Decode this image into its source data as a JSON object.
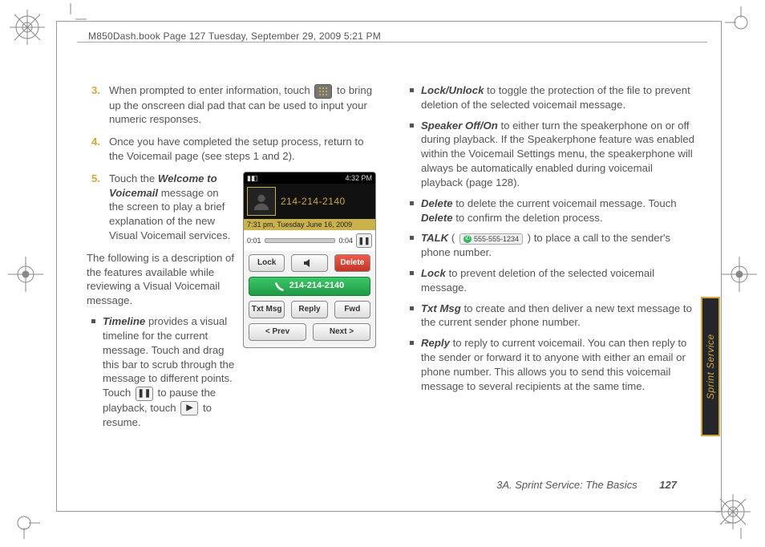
{
  "header": "M850Dash.book  Page 127  Tuesday, September 29, 2009  5:21 PM",
  "steps": {
    "s3": {
      "num": "3.",
      "text_before": "When prompted to enter information, touch ",
      "text_after": " to bring up the onscreen dial pad that can be used to input your numeric responses."
    },
    "s4": {
      "num": "4.",
      "text": "Once you have completed the setup process, return to the Voicemail page (see steps 1 and 2)."
    },
    "s5": {
      "num": "5.",
      "text_before": "Touch the ",
      "kw": "Welcome to Voicemail",
      "text_after": " message on the screen to play a brief explanation of the new Visual Voicemail services."
    }
  },
  "intro": "The following is a description of the features available while reviewing a Visual Voicemail message.",
  "phone": {
    "status_left": "▮◧",
    "status_right": "4:32 PM",
    "phone_number": "214-214-2140",
    "date_line": "7:31 pm, Tuesday  June 16, 2009",
    "scrub_start": "0:01",
    "scrub_end": "0:04",
    "pause_glyph": "❚❚",
    "btn_lock": "Lock",
    "btn_delete": "Delete",
    "call_label": "214-214-2140",
    "btn_txt": "Txt Msg",
    "btn_reply": "Reply",
    "btn_fwd": "Fwd",
    "btn_prev": "<  Prev",
    "btn_next": "Next  >"
  },
  "timeline": {
    "kw": "Timeline",
    "body": " provides a visual timeline for the current message. Touch and drag this bar to scrub through the message to different points. Touch ",
    "mid": " to pause the playback, touch ",
    "tail": " to resume."
  },
  "talk_chip_number": "555-555-1234",
  "right_features": {
    "lockunlock": {
      "kw": "Lock/Unlock",
      "body": " to toggle the protection of the file to prevent deletion of the selected voicemail message."
    },
    "speaker": {
      "kw": "Speaker Off/On",
      "body": " to either turn the speakerphone on or off during playback. If the Speakerphone feature was enabled within the Voicemail Settings menu, the speakerphone will always be automatically enabled during voicemail playback (page 128)."
    },
    "delete": {
      "kw": "Delete",
      "body_before": " to delete the current voicemail message. Touch ",
      "kw2": "Delete",
      "body_after": " to confirm the deletion process."
    },
    "talk": {
      "kw": "TALK",
      "body_before": " (",
      "body_after": ") to place a call to the sender's phone number."
    },
    "lock": {
      "kw": "Lock",
      "body": " to prevent deletion of the selected voicemail message."
    },
    "txtmsg": {
      "kw": "Txt Msg",
      "body": " to create and then deliver a new text message to the current sender phone number."
    },
    "reply": {
      "kw": "Reply",
      "body": " to reply to current voicemail. You can then reply to the sender or forward it to anyone with either an email or phone number. This allows you to send this voicemail message to several recipients at the same time."
    }
  },
  "footer": {
    "section": "3A. Sprint Service: The Basics",
    "page": "127"
  },
  "side_tab": "Sprint Service"
}
